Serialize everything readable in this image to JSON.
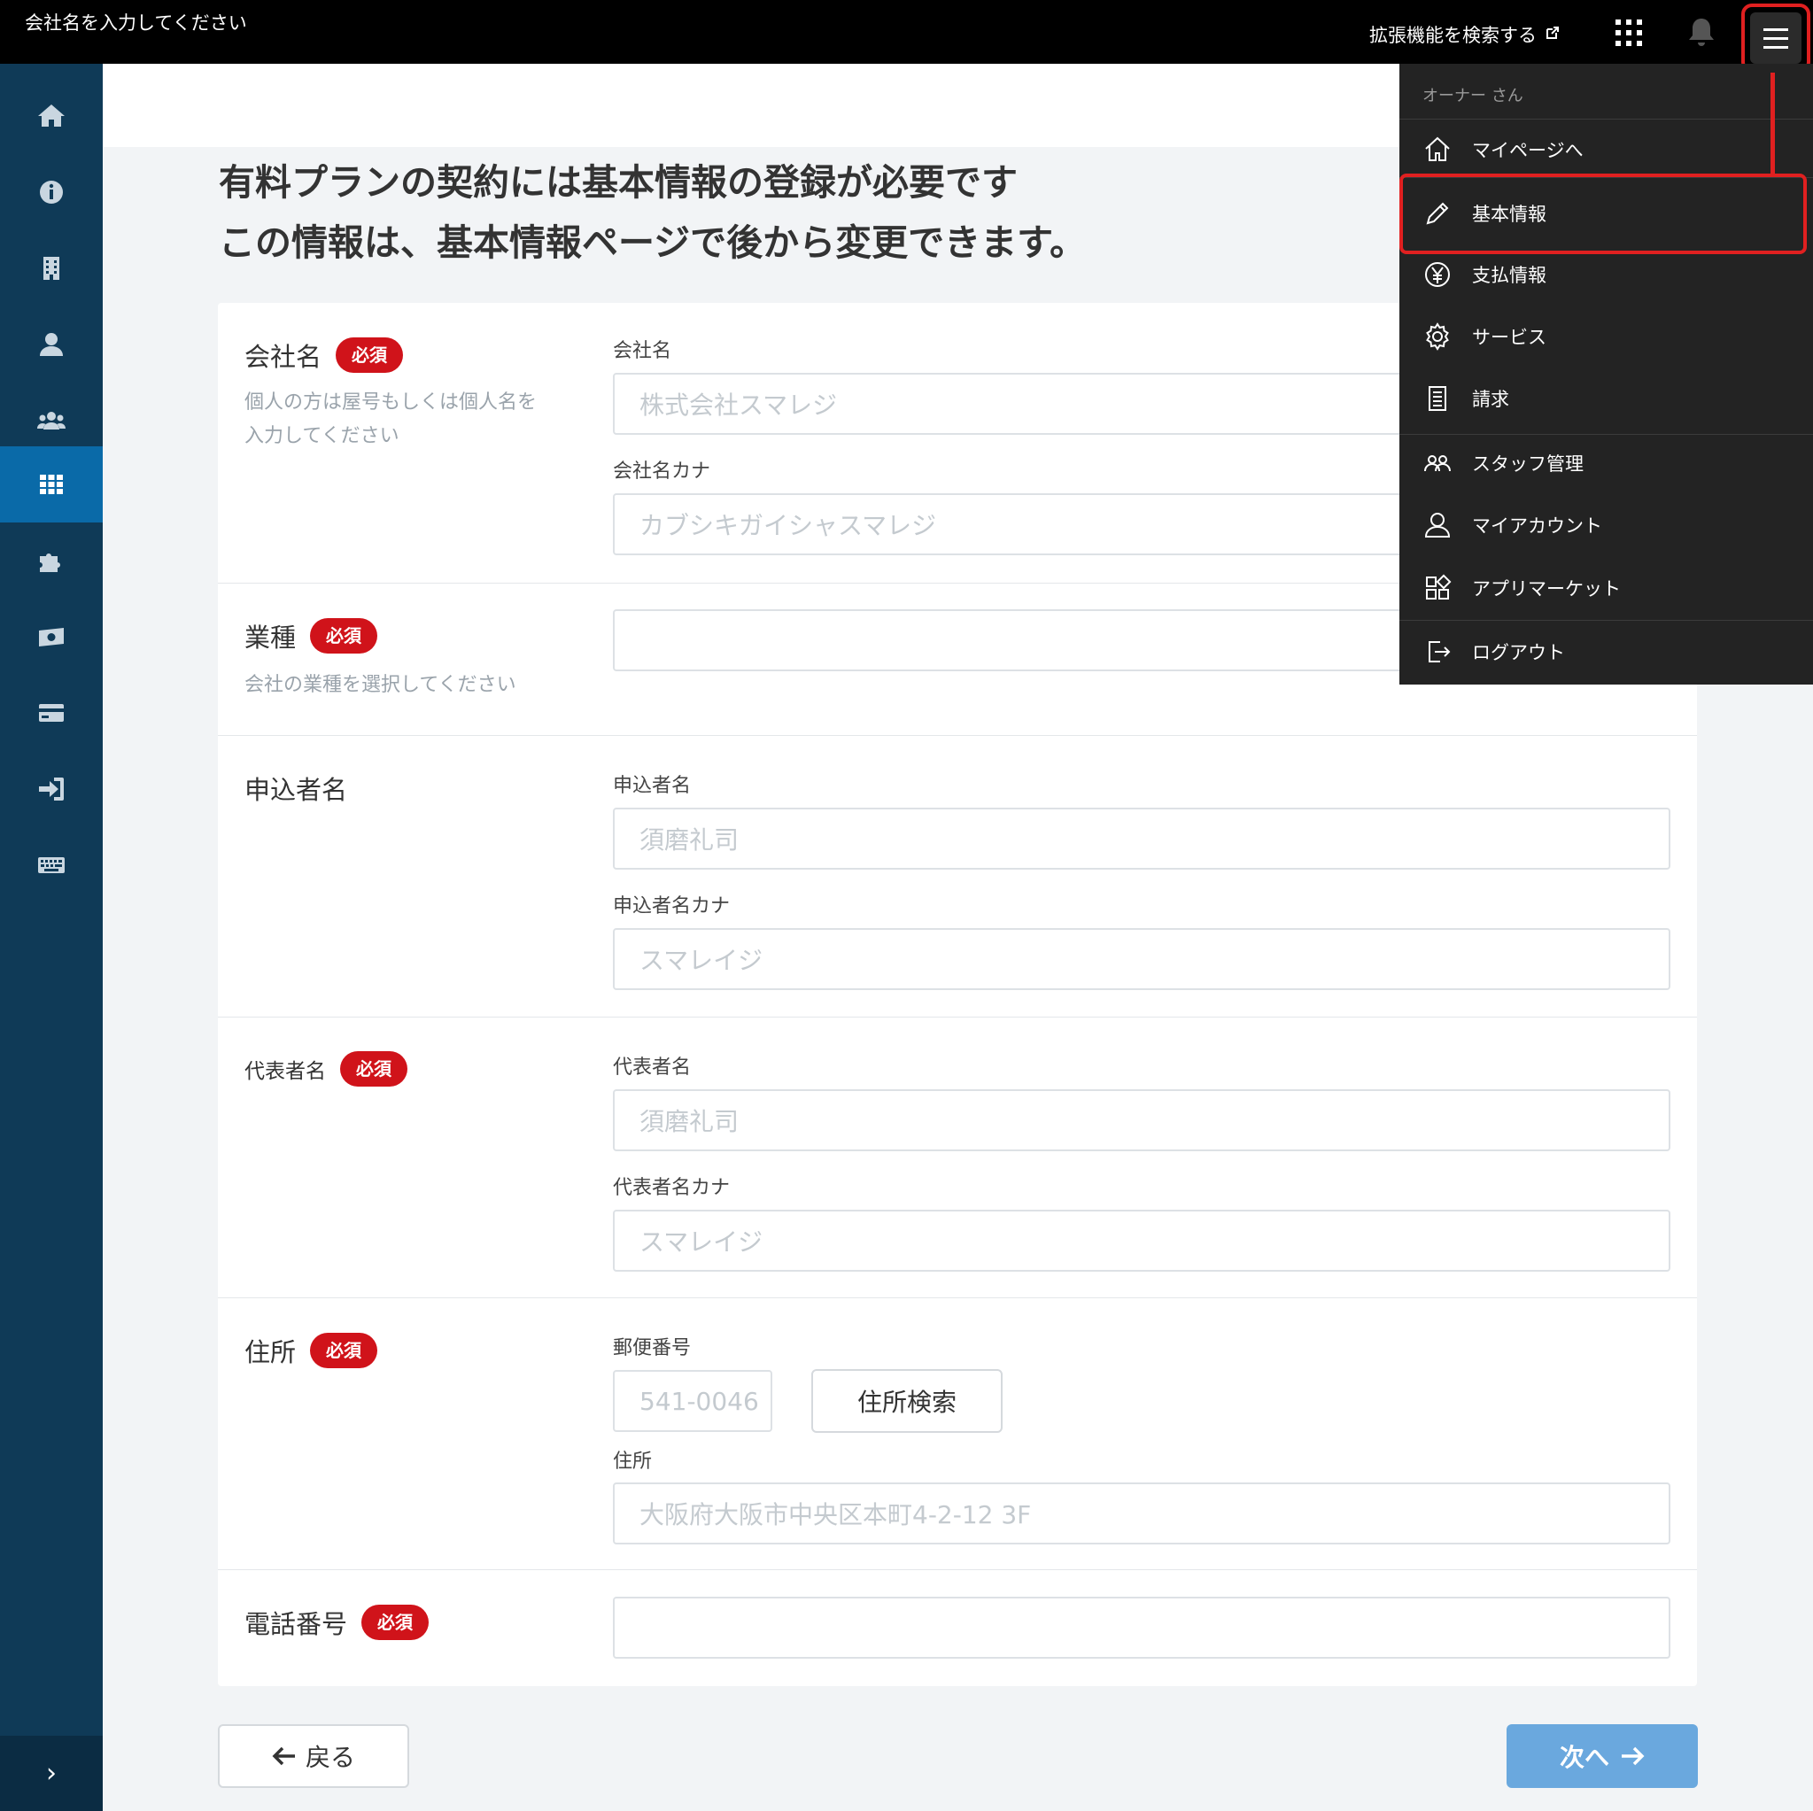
{
  "topbar": {
    "company_placeholder": "会社名を入力してください",
    "extension_link": "拡張機能を検索する",
    "extension_icon": "external-link-icon",
    "apps_icon": "apps-grid-icon",
    "bell_icon": "bell-icon",
    "menu_icon": "hamburger-menu-icon"
  },
  "sidebar": {
    "items": [
      {
        "icon": "home-icon",
        "active": false
      },
      {
        "icon": "info-icon",
        "active": false
      },
      {
        "icon": "building-icon",
        "active": false
      },
      {
        "icon": "user-icon",
        "active": false
      },
      {
        "icon": "users-icon",
        "active": false
      },
      {
        "icon": "grid-icon",
        "active": true
      },
      {
        "icon": "puzzle-icon",
        "active": false
      },
      {
        "icon": "money-icon",
        "active": false
      },
      {
        "icon": "credit-card-icon",
        "active": false
      },
      {
        "icon": "sign-in-icon",
        "active": false
      },
      {
        "icon": "keyboard-icon",
        "active": false
      }
    ],
    "collapse_label": "›"
  },
  "title": {
    "line1": "有料プランの契約には基本情報の登録が必要です",
    "line2": "この情報は、基本情報ページで後から変更できます。"
  },
  "form": {
    "required_badge": "必須",
    "company": {
      "label": "会社名",
      "hint_line1": "個人の方は屋号もしくは個人名を",
      "hint_line2": "入力してください",
      "name_label": "会社名",
      "name_placeholder": "株式会社スマレジ",
      "kana_label": "会社名カナ",
      "kana_placeholder": "カブシキガイシャスマレジ"
    },
    "industry": {
      "label": "業種",
      "hint": "会社の業種を選択してください",
      "value": ""
    },
    "applicant": {
      "label": "申込者名",
      "name_label": "申込者名",
      "name_placeholder": "須磨礼司",
      "kana_label": "申込者名カナ",
      "kana_placeholder": "スマレイジ"
    },
    "representative": {
      "label": "代表者名",
      "name_label": "代表者名",
      "name_placeholder": "須磨礼司",
      "kana_label": "代表者名カナ",
      "kana_placeholder": "スマレイジ"
    },
    "address": {
      "label": "住所",
      "zip_label": "郵便番号",
      "zip_placeholder": "541-0046",
      "search_button": "住所検索",
      "address_label": "住所",
      "address_placeholder": "大阪府大阪市中央区本町4-2-12 3F"
    },
    "phone": {
      "label": "電話番号",
      "value": ""
    }
  },
  "buttons": {
    "back": "戻る",
    "next": "次へ"
  },
  "dropdown": {
    "user": "オーナー さん",
    "items": [
      {
        "label": "マイページへ",
        "icon": "home-outline-icon"
      },
      {
        "label": "基本情報",
        "icon": "pencil-icon",
        "highlighted": true
      },
      {
        "label": "支払情報",
        "icon": "yen-icon"
      },
      {
        "label": "サービス",
        "icon": "gear-icon"
      },
      {
        "label": "請求",
        "icon": "document-icon"
      },
      {
        "label": "スタッフ管理",
        "icon": "staff-icon"
      },
      {
        "label": "マイアカウント",
        "icon": "person-icon"
      },
      {
        "label": "アプリマーケット",
        "icon": "app-market-icon"
      },
      {
        "label": "ログアウト",
        "icon": "logout-icon"
      }
    ]
  },
  "colors": {
    "topbar": "#000000",
    "sidebar": "#0f3a57",
    "sidebar_active": "#0a6aa8",
    "badge": "#d0131a",
    "next_button": "#6aa8de",
    "highlight": "#e02020",
    "dropdown": "#232323"
  }
}
